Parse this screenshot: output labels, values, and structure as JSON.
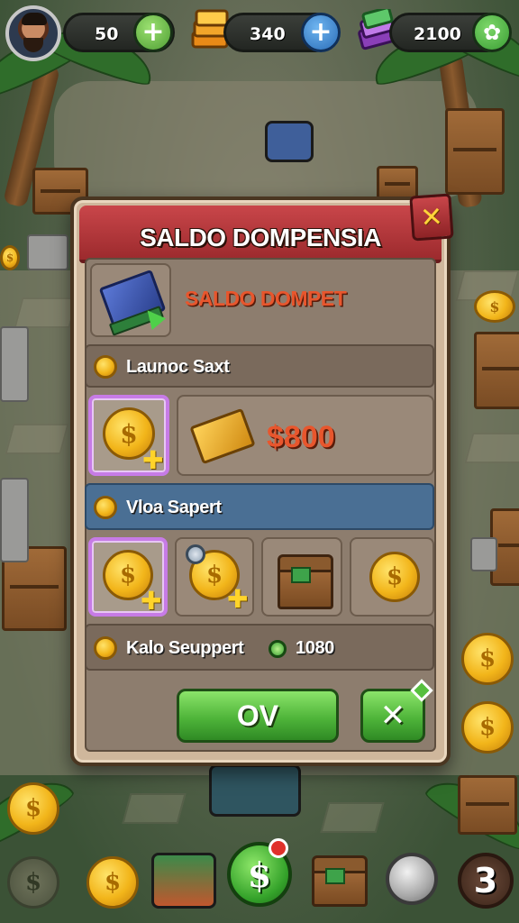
{
  "hud": {
    "lives": "50",
    "cash": "340",
    "gems": "2100",
    "add_lives_symbol": "+",
    "add_cash_symbol": "+",
    "gem_button_symbol": "✿"
  },
  "dialog": {
    "title": "SALDO DOMPENSIA",
    "close_symbol": "✕",
    "subtitle": "SALDO DOMPET",
    "section1_label": "Launoc Saxt",
    "price": "$800",
    "section2_label": "Vloa Sapert",
    "section3_label": "Kalo Seuppert",
    "section3_value": "1080",
    "ok_label": "OV",
    "cancel_symbol": "✕"
  },
  "bottom_bar": {
    "level_badge": "3",
    "dollar_symbol": "$"
  },
  "colors": {
    "banner_red": "#c9464a",
    "ok_green": "#4fb53a",
    "price_orange": "#e8562d",
    "selected_purple": "#c77be6",
    "coin_gold": "#f2b51a"
  }
}
